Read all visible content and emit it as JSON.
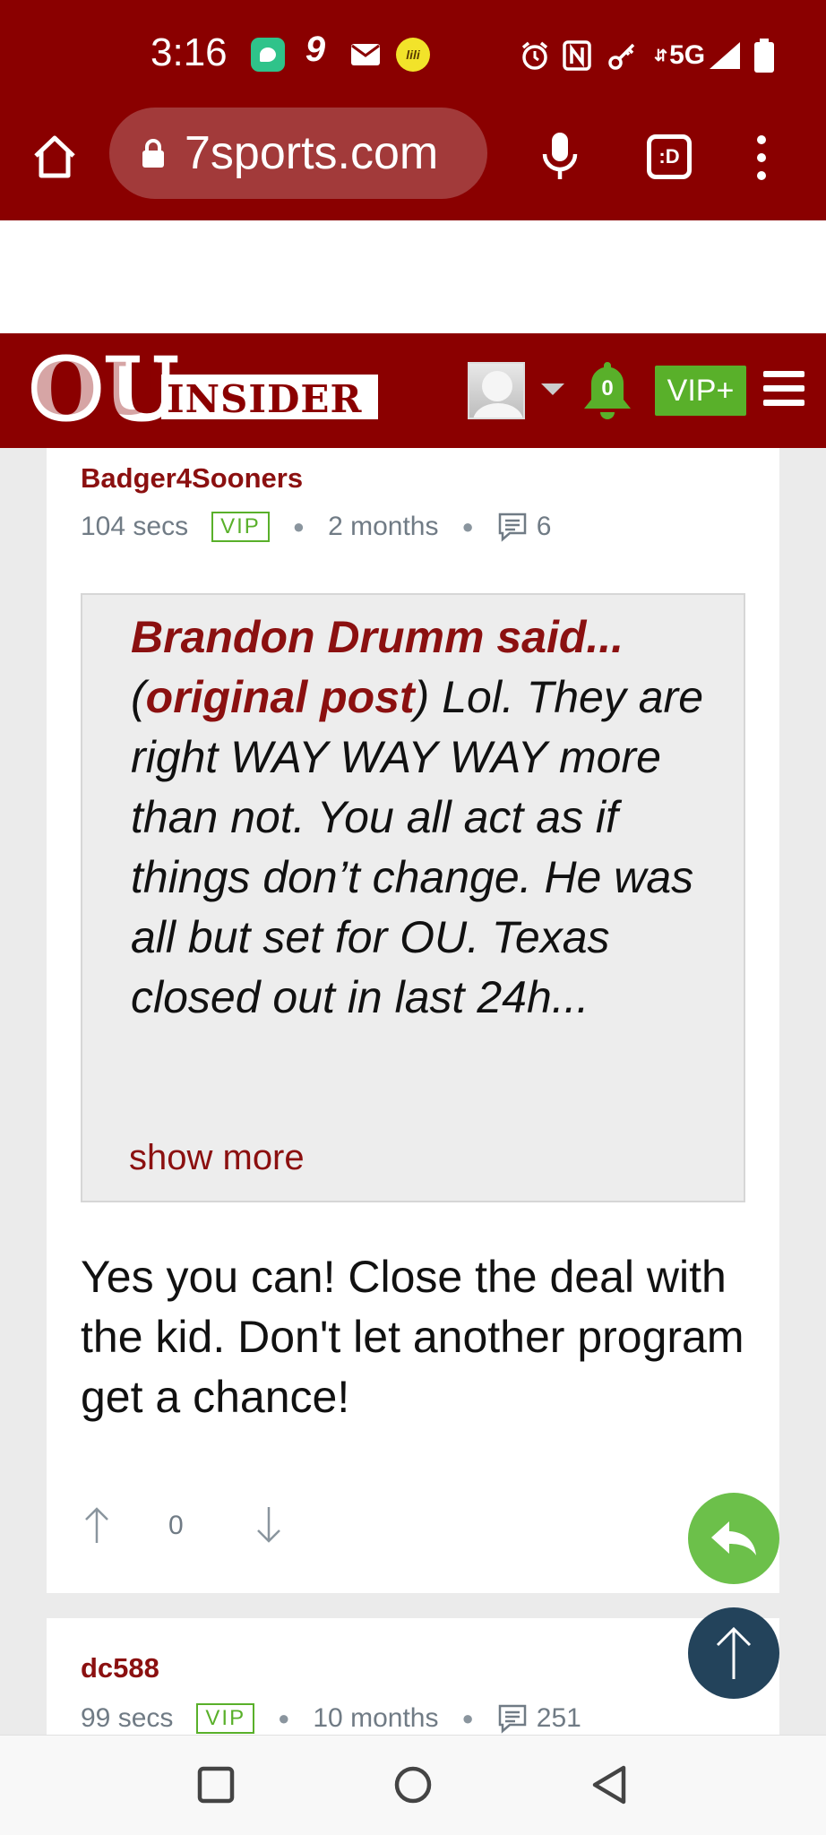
{
  "status_bar": {
    "time": "3:16",
    "network": "5G",
    "app_icons": [
      "messages-icon",
      "nine-icon",
      "gmail-icon",
      "lili-icon"
    ],
    "system_icons": [
      "alarm-icon",
      "nfc-icon",
      "vpn-key-icon",
      "signal-icon",
      "battery-icon"
    ]
  },
  "browser": {
    "url": "7sports.com",
    "tabs_label": ":D"
  },
  "site_header": {
    "logo_text": "OU INSIDER",
    "notification_count": "0",
    "vip_label": "VIP+",
    "colors": {
      "header": "#8b0000",
      "vip_green": "#59b02a"
    }
  },
  "post": {
    "username": "Badger4Sooners",
    "response_time": "104 secs",
    "badge": "VIP",
    "age": "2 months",
    "comment_count": "6",
    "quote": {
      "author_line": "Brandon Drumm said...",
      "open_paren": "(",
      "original_link": "original post",
      "rest": ") Lol. They are right WAY WAY WAY more than not. You all act as if things don’t change. He was all but set for OU. Texas closed out in last 24h...",
      "show_more": "show more"
    },
    "body": "Yes you can! Close the deal with the kid. Don't let another program get a chance!",
    "votes": "0"
  },
  "next_post": {
    "username": "dc588",
    "response_time": "99 secs",
    "badge": "VIP",
    "age": "10 months",
    "comment_count": "251"
  },
  "fab": {
    "reply_color": "#6cc04a",
    "scroll_top_color": "#23435b"
  }
}
